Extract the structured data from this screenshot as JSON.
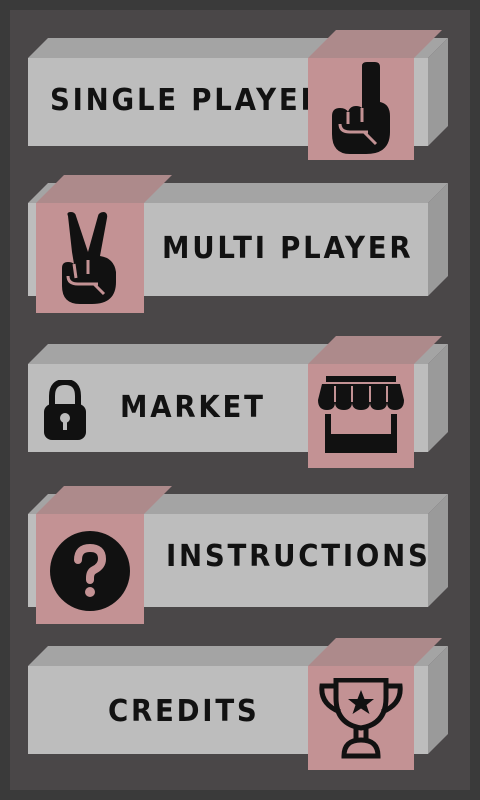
{
  "menu": {
    "single_player": {
      "label": "SINGLE PLAYER",
      "icon": "index-finger-icon"
    },
    "multi_player": {
      "label": "MULTI PLAYER",
      "icon": "victory-hand-icon"
    },
    "market": {
      "label": "MARKET",
      "icon": "storefront-icon",
      "secondary_icon": "lock-icon"
    },
    "instructions": {
      "label": "INSTRUCTIONS",
      "icon": "question-circle-icon"
    },
    "credits": {
      "label": "CREDITS",
      "icon": "trophy-icon"
    }
  },
  "colors": {
    "background": "#3a3a3a",
    "panel": "#4a4748",
    "button_face": "#bdbdbd",
    "button_top": "#a4a4a4",
    "icon_tile": "#c39294",
    "text": "#121212"
  }
}
